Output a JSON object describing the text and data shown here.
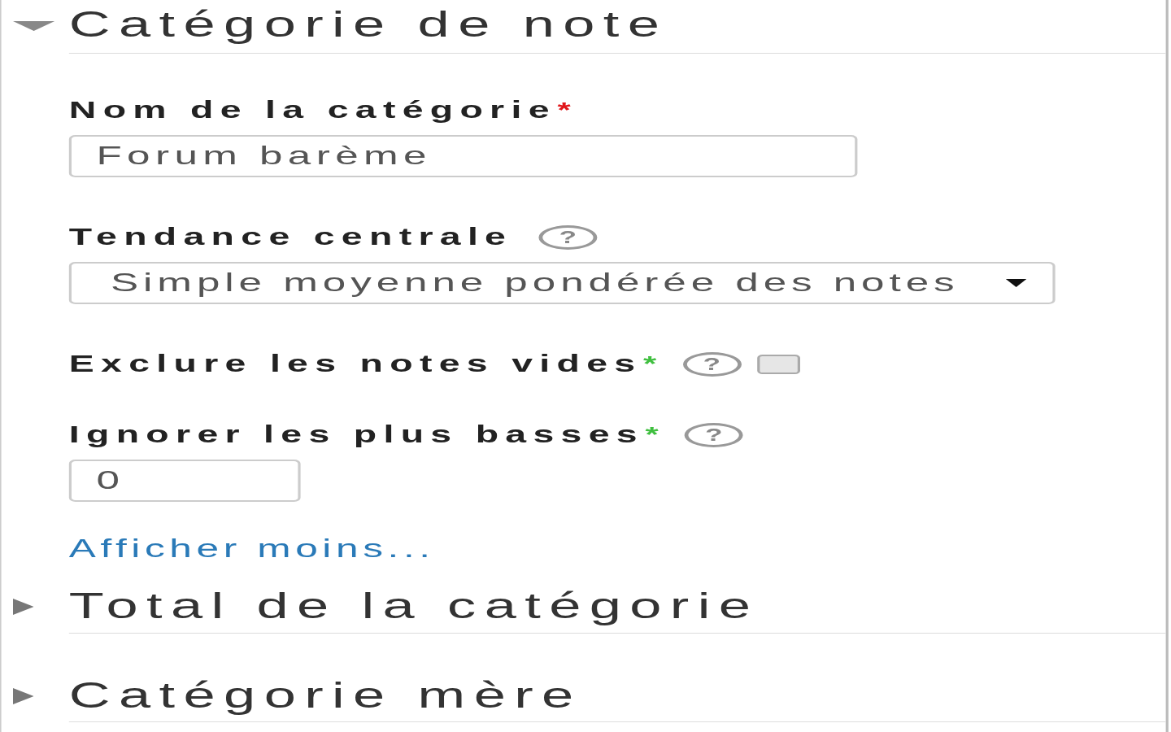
{
  "sections": [
    {
      "title": "Catégorie de note",
      "expanded": true,
      "fields": [
        {
          "kind": "text",
          "label": "Nom de la catégorie",
          "asterisk": {
            "text": "*",
            "color": "#e0161a"
          },
          "value": "Forum barème"
        },
        {
          "kind": "select",
          "label": "Tendance centrale",
          "help": "?",
          "value": "Simple moyenne pondérée des notes"
        },
        {
          "kind": "checkbox",
          "label": "Exclure les notes vides",
          "asterisk": {
            "text": "*",
            "color": "#3fbf3f"
          },
          "help": "?",
          "checked": false
        },
        {
          "kind": "number",
          "label": "Ignorer les plus basses",
          "asterisk": {
            "text": "*",
            "color": "#3fbf3f"
          },
          "help": "?",
          "value": "0"
        }
      ],
      "link": "Afficher moins..."
    },
    {
      "title": "Total de la catégorie",
      "expanded": false
    },
    {
      "title": "Catégorie mère",
      "expanded": false
    }
  ]
}
